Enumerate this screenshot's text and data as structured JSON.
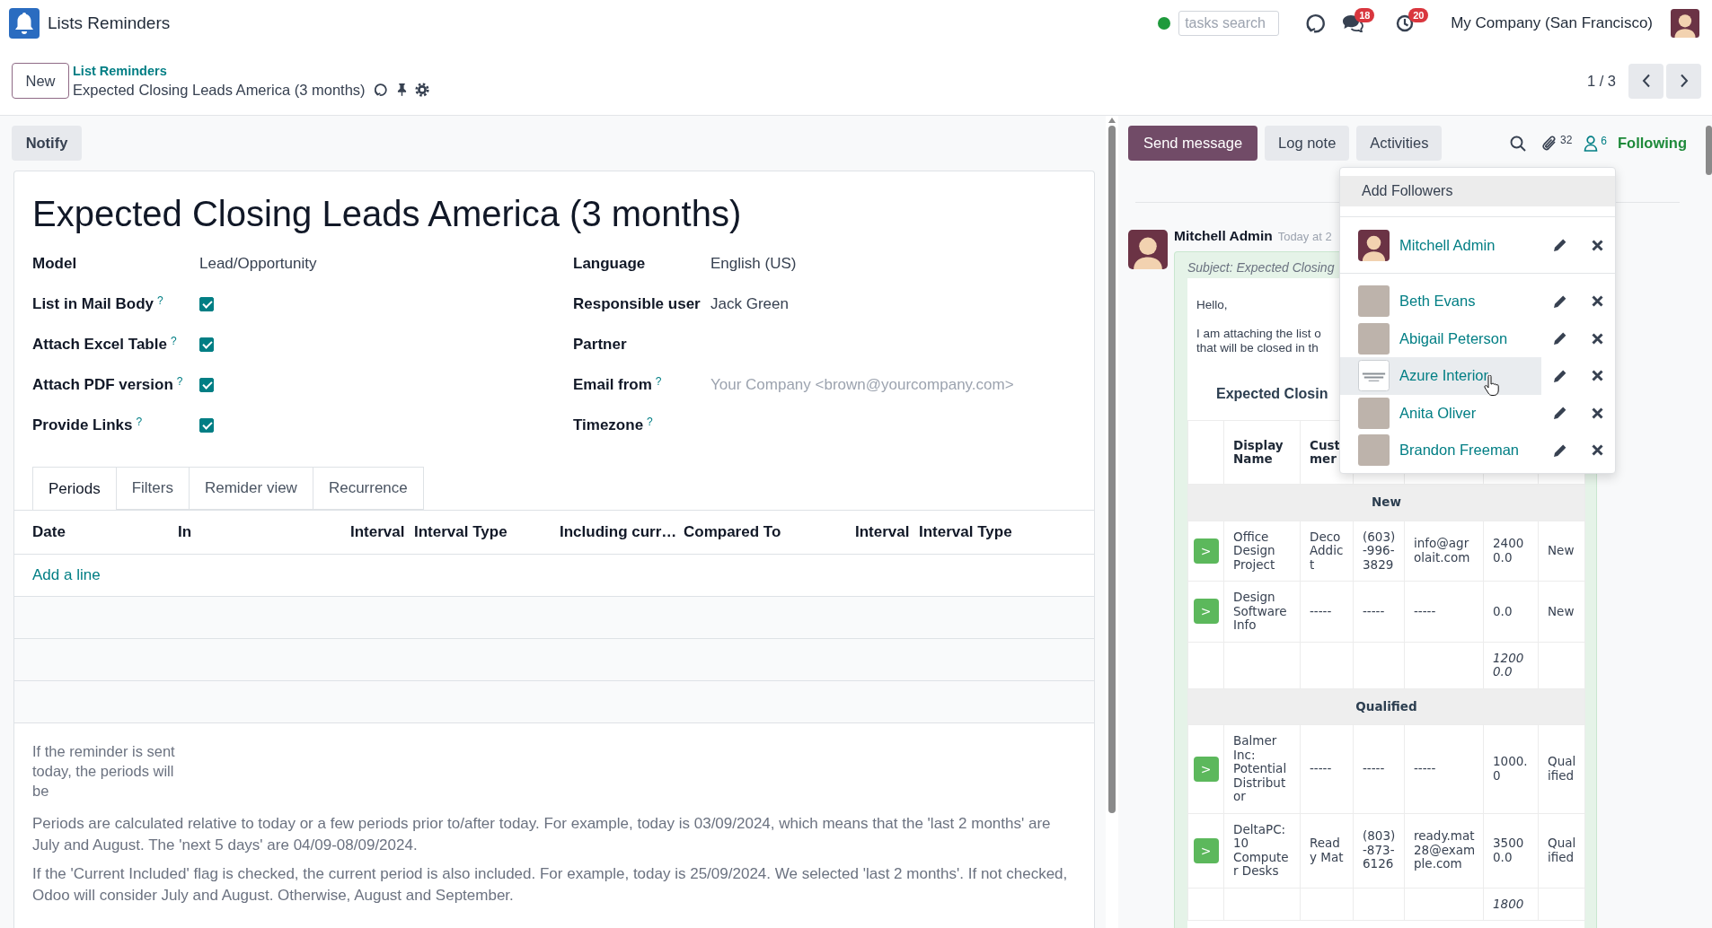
{
  "navbar": {
    "app_name": "Lists Reminders",
    "search": {
      "placeholder": "tasks search"
    },
    "messages_badge": "18",
    "activities_badge": "20",
    "company": "My Company (San Francisco)"
  },
  "control_panel": {
    "new_button": "New",
    "breadcrumb": "List Reminders",
    "record_title": "Expected Closing Leads America (3 months)",
    "pager": "1 / 3"
  },
  "form": {
    "notify_button": "Notify",
    "title": "Expected Closing Leads America (3 months)",
    "left_fields": [
      {
        "label": "Model",
        "kind": "text",
        "value": "Lead/Opportunity"
      },
      {
        "label": "List in Mail Body",
        "help": "?",
        "kind": "checkbox",
        "checked": true
      },
      {
        "label": "Attach Excel Table",
        "help": "?",
        "kind": "checkbox",
        "checked": true
      },
      {
        "label": "Attach PDF version",
        "help": "?",
        "kind": "checkbox",
        "checked": true
      },
      {
        "label": "Provide Links",
        "help": "?",
        "kind": "checkbox",
        "checked": true
      }
    ],
    "right_fields": [
      {
        "label": "Language",
        "kind": "text",
        "value": "English (US)"
      },
      {
        "label": "Responsible user",
        "kind": "text",
        "value": "Jack Green"
      },
      {
        "label": "Partner",
        "kind": "blank"
      },
      {
        "label": "Email from",
        "help": "?",
        "kind": "placeholder",
        "placeholder": "Your Company <brown@yourcompany.com>"
      },
      {
        "label": "Timezone",
        "help": "?",
        "kind": "blank"
      }
    ],
    "tabs": [
      {
        "label": "Periods",
        "selected": true
      },
      {
        "label": "Filters",
        "selected": false
      },
      {
        "label": "Remider view",
        "selected": false
      },
      {
        "label": "Recurrence",
        "selected": false
      }
    ],
    "periods_table": {
      "columns": [
        {
          "label": "Date",
          "kind": "text"
        },
        {
          "label": "In",
          "kind": "text"
        },
        {
          "label": "Interval",
          "kind": "number"
        },
        {
          "label": "Interval Type",
          "kind": "text"
        },
        {
          "label": "Including curr…",
          "kind": "text"
        },
        {
          "label": "Compared To",
          "kind": "text"
        },
        {
          "label": "Interval",
          "kind": "number"
        },
        {
          "label": "Interval Type",
          "kind": "text"
        }
      ],
      "add_line": "Add a line"
    },
    "period_note": "If the reminder is sent today, the periods will be",
    "help_paragraphs": [
      "Periods are calculated relative to today or a few periods prior to/after today. For example, today is 03/09/2024, which means that the 'last 2 months' are July and August. The 'next 5 days' are 04/09-08/09/2024.",
      "If the 'Current Included' flag is checked, the current period is also included. For example, today is 25/09/2024. We selected 'last 2 months'. If not checked, Odoo will consider July and August. Otherwise, August and September."
    ]
  },
  "chatter": {
    "buttons": [
      {
        "label": "Send message",
        "kind": "primary"
      },
      {
        "label": "Log note",
        "kind": "secondary"
      },
      {
        "label": "Activities",
        "kind": "secondary"
      }
    ],
    "attachments_count": "32",
    "followers_count": "6",
    "follow_label": "Following",
    "followers_menu": {
      "add_label": "Add Followers",
      "sections": [
        {
          "followers": [
            {
              "name": "Mitchell Admin",
              "avatar": {
                "kind": "cartoon"
              },
              "hovered": false
            }
          ]
        },
        {
          "followers": [
            {
              "name": "Beth Evans",
              "avatar": {
                "kind": "photo"
              },
              "hovered": false
            },
            {
              "name": "Abigail Peterson",
              "avatar": {
                "kind": "photo"
              },
              "hovered": false
            },
            {
              "name": "Azure Interior",
              "avatar": {
                "kind": "logo"
              },
              "hovered": true
            },
            {
              "name": "Anita Oliver",
              "avatar": {
                "kind": "photo"
              },
              "hovered": false
            },
            {
              "name": "Brandon Freeman",
              "avatar": {
                "kind": "photo"
              },
              "hovered": false
            }
          ]
        }
      ]
    },
    "message": {
      "author": "Mitchell Admin",
      "avatar": {
        "kind": "cartoon"
      },
      "time": "Today at 2",
      "subject": "Subject: Expected Closing",
      "greeting": "Hello,",
      "body_lines": [
        "I am attaching the list o",
        "that will be closed in th"
      ],
      "heading": "Expected Closin",
      "columns": [
        "Display Name",
        "Cust mer"
      ],
      "rows": [
        {
          "kind": "group",
          "label": "New"
        },
        {
          "kind": "record",
          "open": ">",
          "cells": [
            "Office Design Project",
            "Deco Addict",
            "(603)-996-3829",
            "info@agrolait.com",
            "24000.0",
            "New"
          ]
        },
        {
          "kind": "record",
          "open": ">",
          "cells": [
            "Design Software Info",
            "-----",
            "-----",
            "-----",
            "0.0",
            "New"
          ]
        },
        {
          "kind": "subtotal",
          "value": "12000.0"
        },
        {
          "kind": "group",
          "label": "Qualified"
        },
        {
          "kind": "record",
          "open": ">",
          "cells": [
            "Balmer Inc: Potential Distributor",
            "-----",
            "-----",
            "-----",
            "1000.0",
            "Qualified"
          ]
        },
        {
          "kind": "record",
          "open": ">",
          "cells": [
            "DeltaPC: 10 Computer Desks",
            "Ready Mat",
            "(803)-873-6126",
            "ready.mat28@example.com",
            "35000.0",
            "Qualified"
          ]
        },
        {
          "kind": "subtotal",
          "value": "1800"
        }
      ]
    }
  }
}
